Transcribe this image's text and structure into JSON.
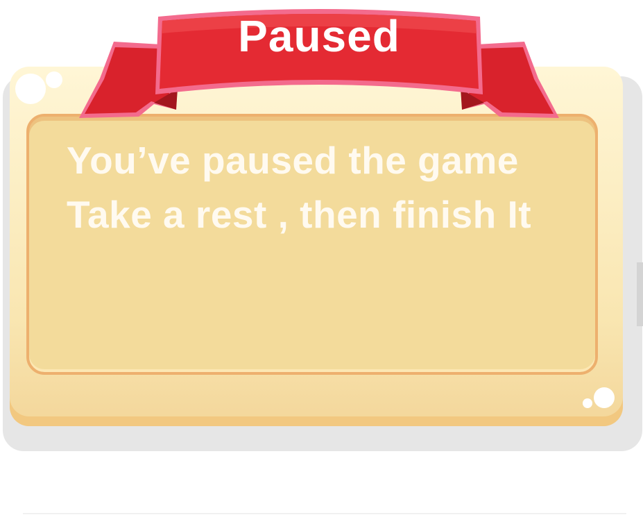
{
  "dialog": {
    "title": "Paused",
    "message_lines": [
      "You’ve paused the game",
      "Take a rest , then finish It"
    ]
  },
  "colors": {
    "ribbon": "#e42a33",
    "ribbon_edge": "#f36b8d",
    "panel": "#f9e6b1",
    "panel_inner": "#f3db9b",
    "panel_border": "#edb06e",
    "text": "#fffaf0"
  }
}
